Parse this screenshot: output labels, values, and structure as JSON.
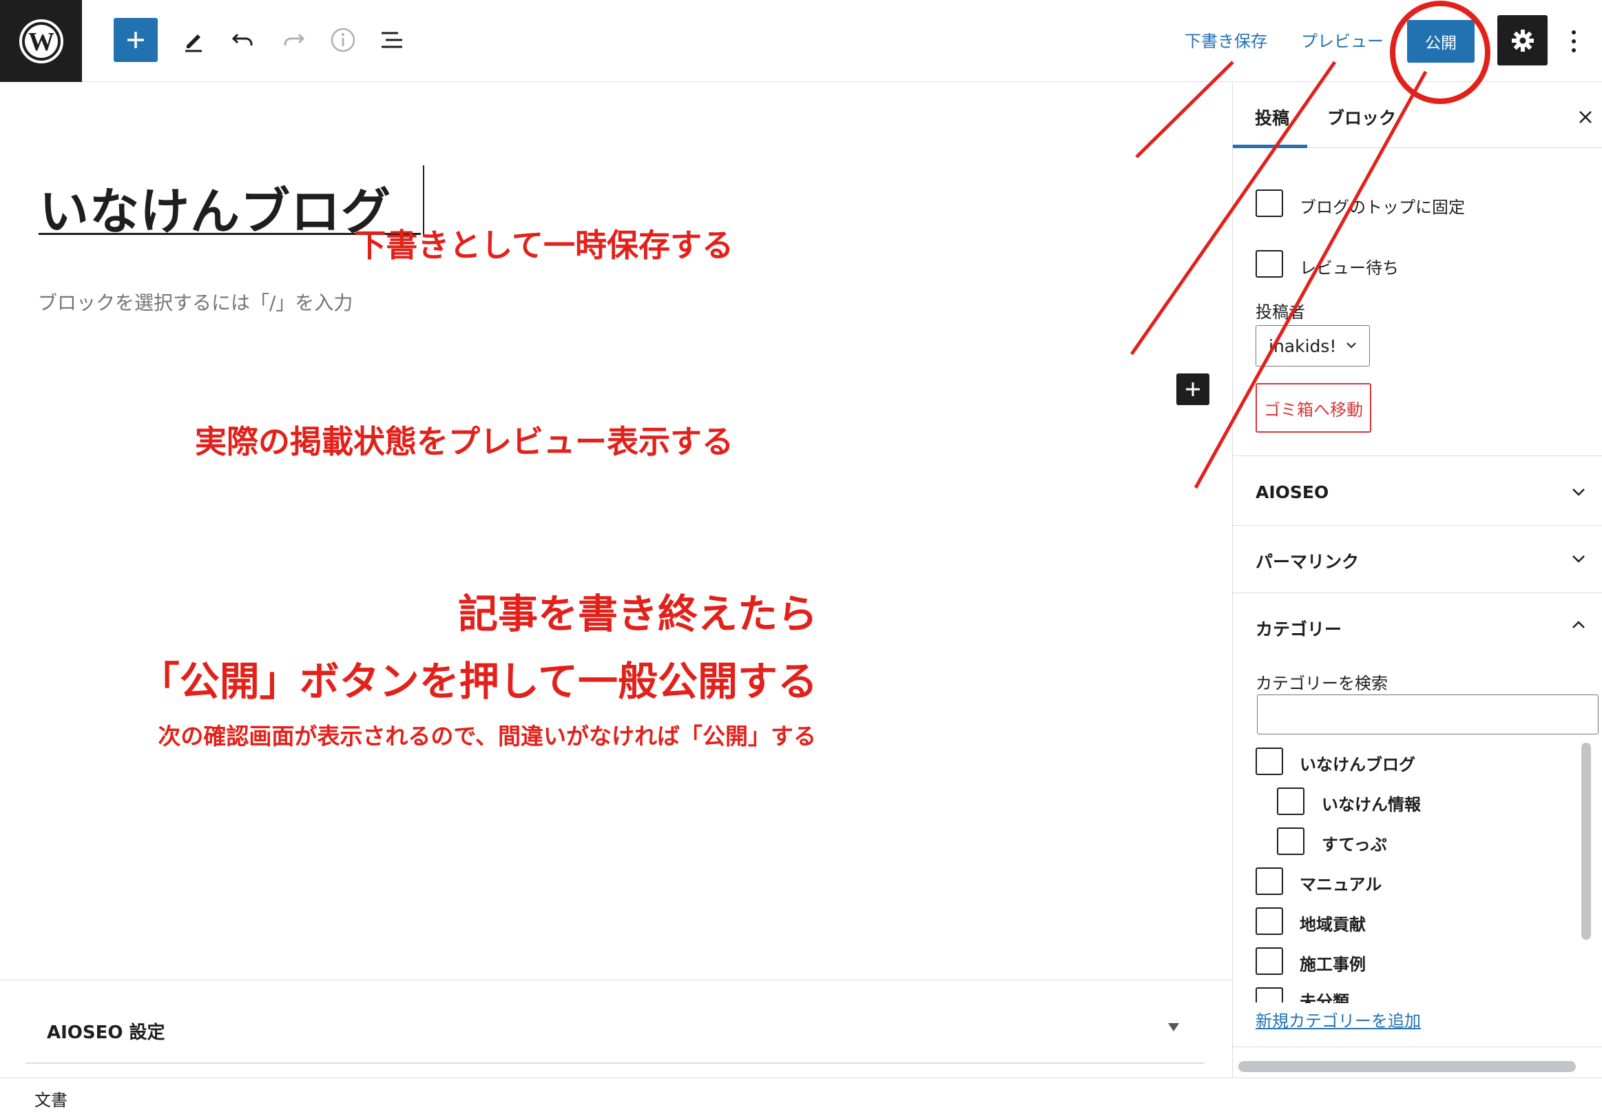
{
  "toolbar": {
    "save_draft_label": "下書き保存",
    "preview_label": "プレビュー",
    "publish_label": "公開"
  },
  "editor": {
    "title": "いなけんブログ",
    "block_placeholder": "ブロックを選択するには「/」を入力"
  },
  "annotations": {
    "save_draft": "下書きとして一時保存する",
    "preview": "実際の掲載状態をプレビュー表示する",
    "publish_line1": "記事を書き終えたら",
    "publish_line2": "「公開」ボタンを押して一般公開する",
    "publish_note": "次の確認画面が表示されるので、間違いがなければ「公開」する",
    "color": "#e3211b"
  },
  "sidebar": {
    "tabs": [
      {
        "label": "投稿"
      },
      {
        "label": "ブロック"
      }
    ],
    "sticky_label": "ブログのトップに固定",
    "pending_label": "レビュー待ち",
    "author_label": "投稿者",
    "author_value": "inakids!",
    "trash_label": "ゴミ箱へ移動",
    "panels": {
      "aioseo": "AIOSEO",
      "permalink": "パーマリンク",
      "categories": "カテゴリー"
    },
    "category_search_label": "カテゴリーを検索",
    "category_search_value": "",
    "categories": [
      {
        "label": "いなけんブログ",
        "checked": false
      },
      {
        "label": "いなけん情報",
        "checked": false
      },
      {
        "label": "すてっぷ",
        "checked": false
      },
      {
        "label": "マニュアル",
        "checked": false
      },
      {
        "label": "地域貢献",
        "checked": false
      },
      {
        "label": "施工事例",
        "checked": false
      },
      {
        "label": "未分類",
        "checked": false
      }
    ],
    "add_category_label": "新規カテゴリーを追加"
  },
  "metabox": {
    "title": "AIOSEO 設定"
  },
  "footer": {
    "breadcrumb": "文書"
  },
  "colors": {
    "accent": "#2271b1",
    "dark": "#1e1e1e",
    "danger": "#d63638"
  }
}
